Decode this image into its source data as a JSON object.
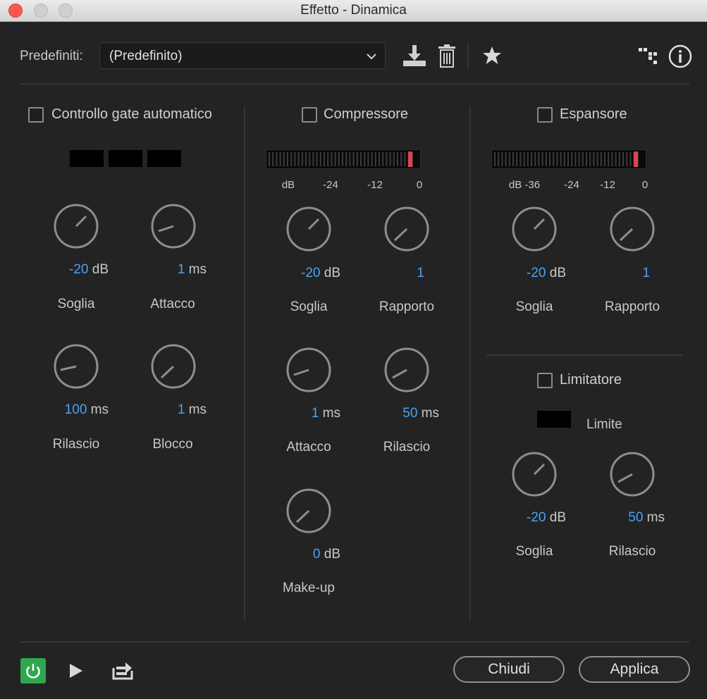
{
  "window": {
    "title": "Effetto - Dinamica"
  },
  "toolbar": {
    "presets_label": "Predefiniti:",
    "preset_value": "(Predefinito)",
    "icons": [
      "chevron-down-icon",
      "download-icon",
      "trash-icon",
      "star-icon",
      "routing-icon",
      "info-icon"
    ]
  },
  "gate": {
    "title": "Controllo gate automatico",
    "knobs": [
      {
        "value": "-20",
        "unit": " dB",
        "label": "Soglia"
      },
      {
        "value": "1",
        "unit": " ms",
        "label": "Attacco"
      },
      {
        "value": "100",
        "unit": " ms",
        "label": "Rilascio"
      },
      {
        "value": "1",
        "unit": " ms",
        "label": "Blocco"
      }
    ]
  },
  "compressor": {
    "title": "Compressore",
    "meter_ticks": [
      "dB",
      "-24",
      "-12",
      "0"
    ],
    "knobs": [
      {
        "value": "-20",
        "unit": " dB",
        "label": "Soglia"
      },
      {
        "value": "1",
        "unit": "",
        "label": "Rapporto"
      },
      {
        "value": "1",
        "unit": " ms",
        "label": "Attacco"
      },
      {
        "value": "50",
        "unit": " ms",
        "label": "Rilascio"
      },
      {
        "value": "0",
        "unit": " dB",
        "label": "Make-up"
      }
    ]
  },
  "expander": {
    "title": "Espansore",
    "meter_ticks": [
      "dB -36",
      "-24",
      "-12",
      "0"
    ],
    "knobs": [
      {
        "value": "-20",
        "unit": " dB",
        "label": "Soglia"
      },
      {
        "value": "1",
        "unit": "",
        "label": "Rapporto"
      }
    ]
  },
  "limiter": {
    "title": "Limitatore",
    "limit_label": "Limite",
    "knobs": [
      {
        "value": "-20",
        "unit": " dB",
        "label": "Soglia"
      },
      {
        "value": "50",
        "unit": " ms",
        "label": "Rilascio"
      }
    ]
  },
  "footer": {
    "close_label": "Chiudi",
    "apply_label": "Applica",
    "icons": [
      "power-icon",
      "play-icon",
      "export-icon"
    ]
  },
  "colors": {
    "accent_value": "#4aa3f5",
    "power": "#2fa74f",
    "meter_peak": "#e04050"
  }
}
